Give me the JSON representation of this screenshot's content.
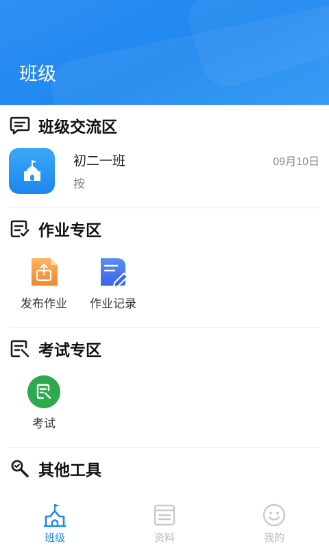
{
  "header": {
    "title": "班级"
  },
  "sections": {
    "chat": {
      "title": "班级交流区"
    },
    "homework": {
      "title": "作业专区"
    },
    "exam": {
      "title": "考试专区"
    },
    "tools": {
      "title": "其他工具"
    }
  },
  "chat_item": {
    "name": "初二一班",
    "preview": "按",
    "time": "09月10日",
    "avatar_icon": "school-icon"
  },
  "homework_tools": [
    {
      "label": "发布作业",
      "icon": "upload-doc-icon",
      "color": "#f79a3e"
    },
    {
      "label": "作业记录",
      "icon": "edit-doc-icon",
      "color": "#3f6ff0"
    }
  ],
  "exam_tools": [
    {
      "label": "考试",
      "icon": "exam-icon",
      "color": "#2faa4e"
    }
  ],
  "tabs": [
    {
      "label": "班级",
      "icon": "school-icon",
      "active": true
    },
    {
      "label": "资料",
      "icon": "book-icon",
      "active": false
    },
    {
      "label": "我的",
      "icon": "smile-icon",
      "active": false
    }
  ],
  "colors": {
    "accent": "#1e88f0",
    "inactive": "#c9c9c9"
  }
}
